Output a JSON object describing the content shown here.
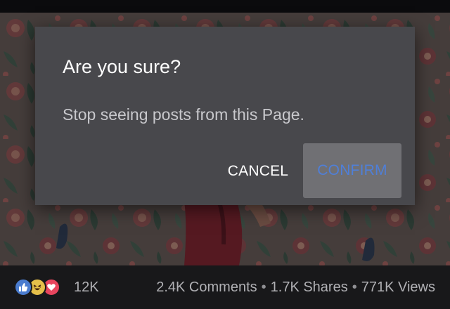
{
  "dialog": {
    "title": "Are you sure?",
    "message": "Stop seeing posts from this Page.",
    "cancel_label": "CANCEL",
    "confirm_label": "CONFIRM"
  },
  "post_stats": {
    "reactions": [
      {
        "type": "like",
        "icon": "thumbs-up-icon",
        "color": "#4a7ccf"
      },
      {
        "type": "haha",
        "icon": "laughing-face-icon",
        "color": "#e6c04a"
      },
      {
        "type": "love",
        "icon": "heart-icon",
        "color": "#e8455e"
      }
    ],
    "reaction_count": "12K",
    "comments": "2.4K Comments",
    "shares": "1.7K Shares",
    "views": "771K Views",
    "separator": "•"
  },
  "colors": {
    "dialog_background": "#48484c",
    "confirm_text": "#4f7fd8",
    "confirm_background": "#707074",
    "stats_text": "#b0b0b4",
    "stats_background": "#18181a"
  }
}
